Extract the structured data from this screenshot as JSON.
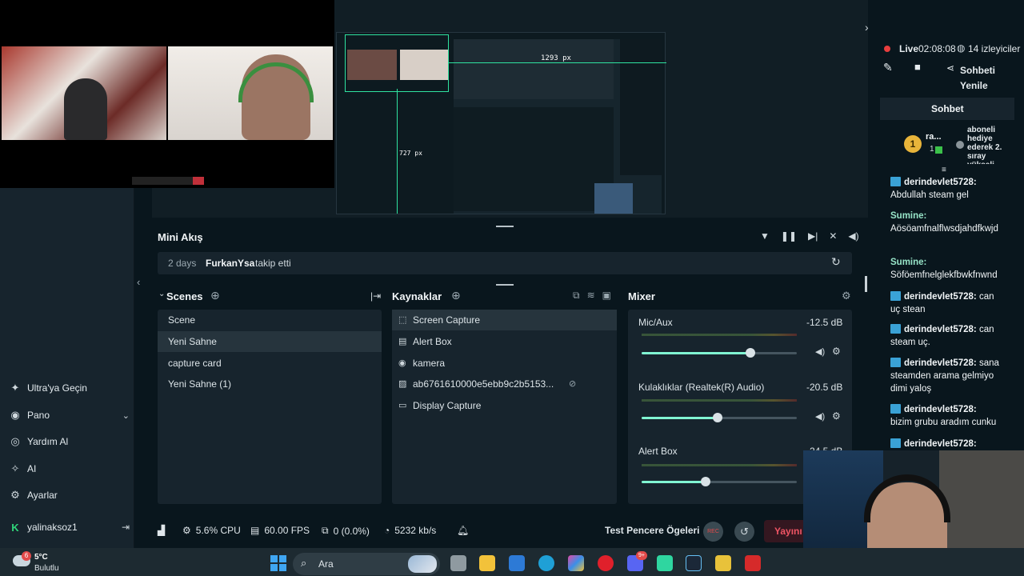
{
  "window": {
    "minimize": "—",
    "maximize": "☐",
    "close": "✕"
  },
  "nav": {
    "items": [
      {
        "label": "Ultra'ya Geçin",
        "icon": "ultra-icon"
      },
      {
        "label": "Pano",
        "icon": "dashboard-icon"
      },
      {
        "label": "Yardım Al",
        "icon": "help-icon"
      },
      {
        "label": "AI",
        "icon": "ai-icon"
      },
      {
        "label": "Ayarlar",
        "icon": "gear-icon"
      }
    ],
    "user": "yalinaksoz1"
  },
  "preview": {
    "dim_w": "1293 px",
    "dim_h": "727 px"
  },
  "mini_akis": {
    "title": "Mini Akış",
    "event": {
      "time": "2 days",
      "user": "FurkanYsa",
      "action": "takip etti"
    }
  },
  "scenes": {
    "title": "Scenes",
    "items": [
      "Scene",
      "Yeni Sahne",
      "capture card",
      "Yeni Sahne (1)"
    ],
    "selected": 1
  },
  "sources": {
    "title": "Kaynaklar",
    "items": [
      {
        "label": "Screen Capture",
        "icon": "screen-capture-icon"
      },
      {
        "label": "Alert Box",
        "icon": "alert-box-icon"
      },
      {
        "label": "kamera",
        "icon": "camera-icon"
      },
      {
        "label": "ab6761610000e5ebb9c2b5153...",
        "icon": "image-icon"
      },
      {
        "label": "Display Capture",
        "icon": "display-icon"
      }
    ]
  },
  "mixer": {
    "title": "Mixer",
    "channels": [
      {
        "name": "Mic/Aux",
        "db": "-12.5 dB",
        "level": 0.7
      },
      {
        "name": "Kulaklıklar (Realtek(R) Audio)",
        "db": "-20.5 dB",
        "level": 0.49
      },
      {
        "name": "Alert Box",
        "db": "-24.5 dB",
        "level": 0.41
      }
    ]
  },
  "status": {
    "cpu": "5.6% CPU",
    "fps": "60.00 FPS",
    "dropped": "0 (0.0%)",
    "bitrate": "5232 kb/s",
    "test_label": "Test Pencere Ögeleri",
    "rec": "REC",
    "live_button": "Yayını S"
  },
  "chat": {
    "live_label": "Live",
    "timer": "02:08:08",
    "viewers": "14 izleyiciler",
    "refresh_label": "Sohbeti Yenile",
    "title": "Sohbet",
    "gift_rank": "1",
    "gift_user": "ra...",
    "gift_count": "1",
    "gift_text": "aboneli hediye ederek 2. sıray yükseli",
    "messages": [
      {
        "user": "derindevlet5728:",
        "text": "Abdullah steam gel",
        "badge": true
      },
      {
        "user": "Sumine:",
        "text": "Aösöamfnalflwsdjahdfkwjd",
        "badge": false
      },
      {
        "user": "Sumine:",
        "text": "Söföemfnelglekfbwkfnwnd",
        "badge": false
      },
      {
        "user": "derindevlet5728:",
        "text": "can uç stean",
        "badge": true
      },
      {
        "user": "derindevlet5728:",
        "text": "can steam uç.",
        "badge": true
      },
      {
        "user": "derindevlet5728:",
        "text": "sana steamden arama gelmiyo dimi yaloş",
        "badge": true
      },
      {
        "user": "derindevlet5728:",
        "text": "bizim grubu aradım cunku",
        "badge": true
      },
      {
        "user": "derindevlet5728:",
        "text": "",
        "badge": true
      }
    ]
  },
  "taskbar": {
    "temp": "5°C",
    "weather": "Bulutlu",
    "weather_badge": "6",
    "search": "Ara",
    "discord_badge": "9+"
  }
}
